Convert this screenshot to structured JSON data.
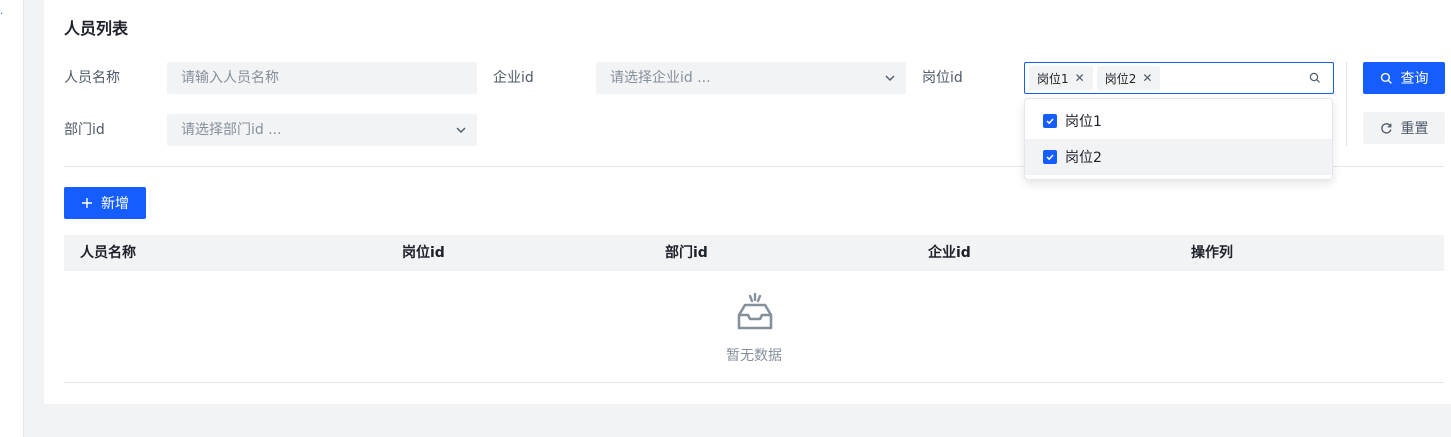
{
  "page": {
    "title": "人员列表"
  },
  "filters": {
    "name_label": "人员名称",
    "name_placeholder": "请输入人员名称",
    "company_label": "企业id",
    "company_placeholder": "请选择企业id ...",
    "post_label": "岗位id",
    "post_tags": [
      "岗位1",
      "岗位2"
    ],
    "dept_label": "部门id",
    "dept_placeholder": "请选择部门id ...",
    "post_options": [
      {
        "label": "岗位1",
        "checked": true
      },
      {
        "label": "岗位2",
        "checked": true
      }
    ]
  },
  "actions": {
    "query_label": "查询",
    "reset_label": "重置",
    "add_label": "新增"
  },
  "table": {
    "columns": [
      "人员名称",
      "岗位id",
      "部门id",
      "企业id",
      "操作列"
    ],
    "empty_text": "暂无数据"
  },
  "colors": {
    "accent": "#165dff",
    "muted": "#86909c",
    "panel": "#f2f3f5"
  }
}
